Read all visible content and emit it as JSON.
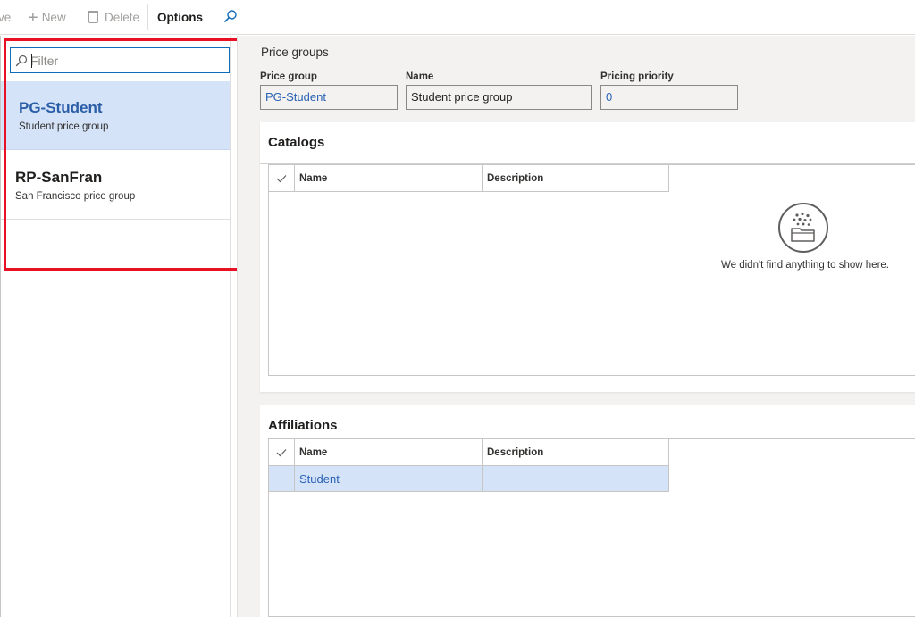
{
  "toolbar": {
    "save_label": "ve",
    "new_label": "New",
    "delete_label": "Delete",
    "options_label": "Options",
    "search_icon": "search-icon"
  },
  "list": {
    "filter_placeholder": "Filter",
    "items": [
      {
        "title": "PG-Student",
        "subtitle": "Student price group",
        "selected": true
      },
      {
        "title": "RP-SanFran",
        "subtitle": "San Francisco price group",
        "selected": false
      }
    ]
  },
  "details": {
    "caption": "Price groups",
    "fields": {
      "price_group": {
        "label": "Price group",
        "value": "PG-Student"
      },
      "name": {
        "label": "Name",
        "value": "Student price group"
      },
      "pricing_priority": {
        "label": "Pricing priority",
        "value": "0"
      }
    }
  },
  "catalogs": {
    "title": "Catalogs",
    "columns": [
      "Name",
      "Description"
    ],
    "rows": [],
    "empty_message": "We didn't find anything to show here."
  },
  "affiliations": {
    "title": "Affiliations",
    "columns": [
      "Name",
      "Description"
    ],
    "rows": [
      {
        "name": "Student",
        "description": ""
      }
    ]
  },
  "colors": {
    "accent": "#0f6cbd",
    "selection": "#d5e3f9",
    "link": "#2b62b5",
    "highlight_box": "#e81123"
  }
}
